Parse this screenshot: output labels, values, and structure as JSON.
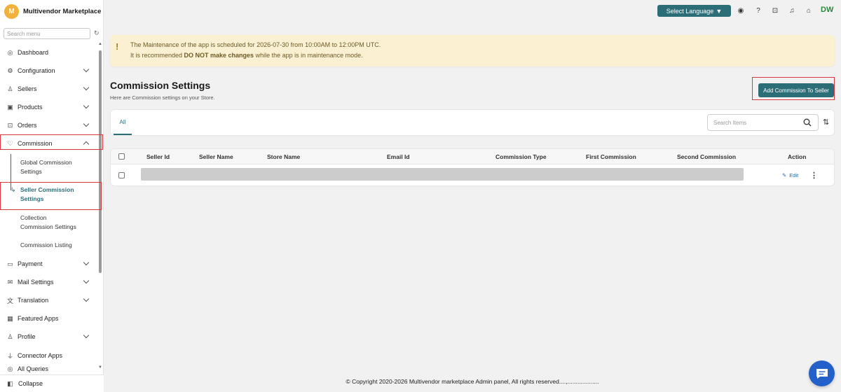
{
  "brand": {
    "avatar_letter": "M",
    "name": "Multivendor Marketplace"
  },
  "sidebar": {
    "search_placeholder": "Search menu",
    "items": [
      {
        "label": "Dashboard",
        "icon": "dashboard-icon"
      },
      {
        "label": "Configuration",
        "icon": "gear-icon"
      },
      {
        "label": "Sellers",
        "icon": "person-icon"
      },
      {
        "label": "Products",
        "icon": "product-icon"
      },
      {
        "label": "Orders",
        "icon": "orders-icon"
      },
      {
        "label": "Commission",
        "icon": "commission-icon"
      },
      {
        "label": "Payment",
        "icon": "payment-icon"
      },
      {
        "label": "Mail Settings",
        "icon": "mail-icon"
      },
      {
        "label": "Translation",
        "icon": "translate-icon"
      },
      {
        "label": "Featured Apps",
        "icon": "apps-icon"
      },
      {
        "label": "Profile",
        "icon": "person-icon"
      },
      {
        "label": "Connector Apps",
        "icon": "plug-icon"
      },
      {
        "label": "All Queries",
        "icon": "query-icon"
      }
    ],
    "commission_sub": {
      "global_line1": "Global Commission",
      "global_line2": "Settings",
      "seller_line1": "Seller Commission",
      "seller_line2": "Settings",
      "collection_line1": "Collection",
      "collection_line2": "Commission Settings",
      "listing": "Commission Listing"
    },
    "collapse_label": "Collapse"
  },
  "topbar": {
    "language_label": "Select Language",
    "user_initials": "DW"
  },
  "banner": {
    "line1": "The Maintenance of the app is scheduled for 2026-07-30 from 10:00AM to 12:00PM UTC.",
    "line2_prefix": "It is recommended ",
    "line2_bold": "DO NOT make changes",
    "line2_suffix": " while the app is in maintenance mode."
  },
  "page": {
    "title": "Commission Settings",
    "subtitle": "Here are Commission settings on your Store.",
    "add_button": "Add Commission To Seller"
  },
  "tabs": {
    "all": "All"
  },
  "search": {
    "placeholder": "Search Items"
  },
  "table": {
    "columns": [
      "Seller Id",
      "Seller Name",
      "Store Name",
      "Email Id",
      "Commission Type",
      "First Commission",
      "Second Commission",
      "Action"
    ],
    "row_action": "Edit"
  },
  "footer": {
    "copyright": "© Copyright 2020-2026 Multivendor marketplace Admin panel, All rights reserved....,..................."
  },
  "colors": {
    "accent": "#2c6e78",
    "highlight": "#d9363e",
    "banner_bg": "#fbf1d2",
    "chat": "#2360c9"
  }
}
